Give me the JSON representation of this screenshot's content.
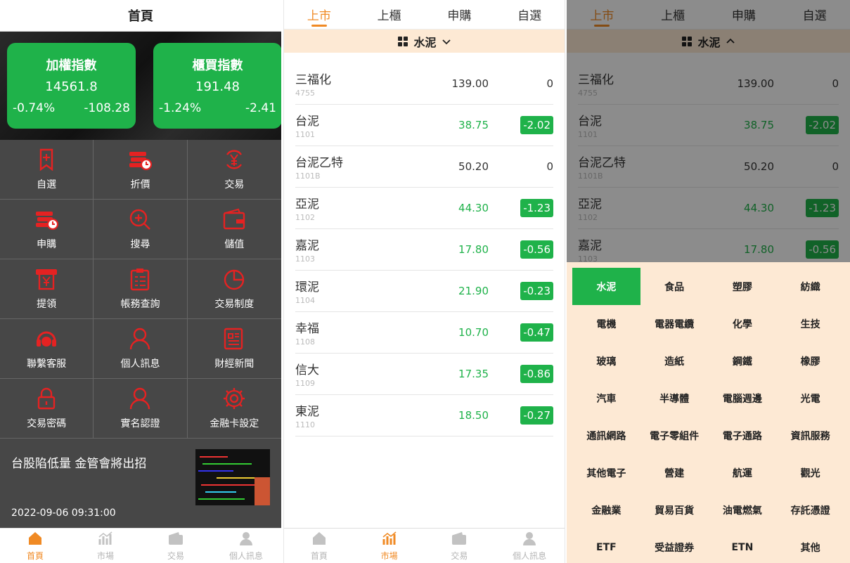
{
  "colors": {
    "brand_green": "#1fb24a",
    "accent_orange": "#f08a24",
    "icon_red": "#e52222",
    "cat_bg": "#fde9d4"
  },
  "home": {
    "title": "首頁",
    "indices": [
      {
        "name": "加權指數",
        "value": "14561.8",
        "pct": "-0.74%",
        "chg": "-108.28"
      },
      {
        "name": "櫃買指數",
        "value": "191.48",
        "pct": "-1.24%",
        "chg": "-2.41"
      }
    ],
    "menu": [
      {
        "label": "自選",
        "icon": "bookmark-icon"
      },
      {
        "label": "折價",
        "icon": "coins-clock-icon"
      },
      {
        "label": "交易",
        "icon": "yen-cycle-icon"
      },
      {
        "label": "申購",
        "icon": "coins-clock-icon"
      },
      {
        "label": "搜尋",
        "icon": "search-plus-icon"
      },
      {
        "label": "儲值",
        "icon": "wallet-icon"
      },
      {
        "label": "提領",
        "icon": "atm-yen-icon"
      },
      {
        "label": "帳務查詢",
        "icon": "clipboard-icon"
      },
      {
        "label": "交易制度",
        "icon": "pie-icon"
      },
      {
        "label": "聯繫客服",
        "icon": "headset-icon"
      },
      {
        "label": "個人訊息",
        "icon": "user-icon"
      },
      {
        "label": "財經新聞",
        "icon": "newspaper-icon"
      },
      {
        "label": "交易密碼",
        "icon": "lock-icon"
      },
      {
        "label": "實名認證",
        "icon": "user-icon"
      },
      {
        "label": "金融卡設定",
        "icon": "gear-icon"
      }
    ],
    "news": {
      "title": "台股陷低量 金管會將出招",
      "time": "2022-09-06 09:31:00"
    }
  },
  "tabbar": {
    "items": [
      {
        "label": "首頁",
        "icon": "home-icon"
      },
      {
        "label": "市場",
        "icon": "chart-icon"
      },
      {
        "label": "交易",
        "icon": "wallet-icon"
      },
      {
        "label": "個人訊息",
        "icon": "user-icon"
      }
    ]
  },
  "market": {
    "tabs": [
      "上市",
      "上櫃",
      "申購",
      "自選"
    ],
    "active_tab": "上市",
    "category": "水泥",
    "stocks": [
      {
        "name": "三福化",
        "code": "4755",
        "price": "139.00",
        "change": "0",
        "trend": "flat"
      },
      {
        "name": "台泥",
        "code": "1101",
        "price": "38.75",
        "change": "-2.02",
        "trend": "down"
      },
      {
        "name": "台泥乙特",
        "code": "1101B",
        "price": "50.20",
        "change": "0",
        "trend": "flat"
      },
      {
        "name": "亞泥",
        "code": "1102",
        "price": "44.30",
        "change": "-1.23",
        "trend": "down"
      },
      {
        "name": "嘉泥",
        "code": "1103",
        "price": "17.80",
        "change": "-0.56",
        "trend": "down"
      },
      {
        "name": "環泥",
        "code": "1104",
        "price": "21.90",
        "change": "-0.23",
        "trend": "down"
      },
      {
        "name": "幸福",
        "code": "1108",
        "price": "10.70",
        "change": "-0.47",
        "trend": "down"
      },
      {
        "name": "信大",
        "code": "1109",
        "price": "17.35",
        "change": "-0.86",
        "trend": "down"
      },
      {
        "name": "東泥",
        "code": "1110",
        "price": "18.50",
        "change": "-0.27",
        "trend": "down"
      }
    ],
    "categories": [
      "水泥",
      "食品",
      "塑膠",
      "紡織",
      "電機",
      "電器電纜",
      "化學",
      "生技",
      "玻璃",
      "造紙",
      "鋼鐵",
      "橡膠",
      "汽車",
      "半導體",
      "電腦週邊",
      "光電",
      "通訊網路",
      "電子零組件",
      "電子通路",
      "資訊服務",
      "其他電子",
      "營建",
      "航運",
      "觀光",
      "金融業",
      "貿易百貨",
      "油電燃氣",
      "存託憑證",
      "ETF",
      "受益證券",
      "ETN",
      "其他"
    ]
  }
}
